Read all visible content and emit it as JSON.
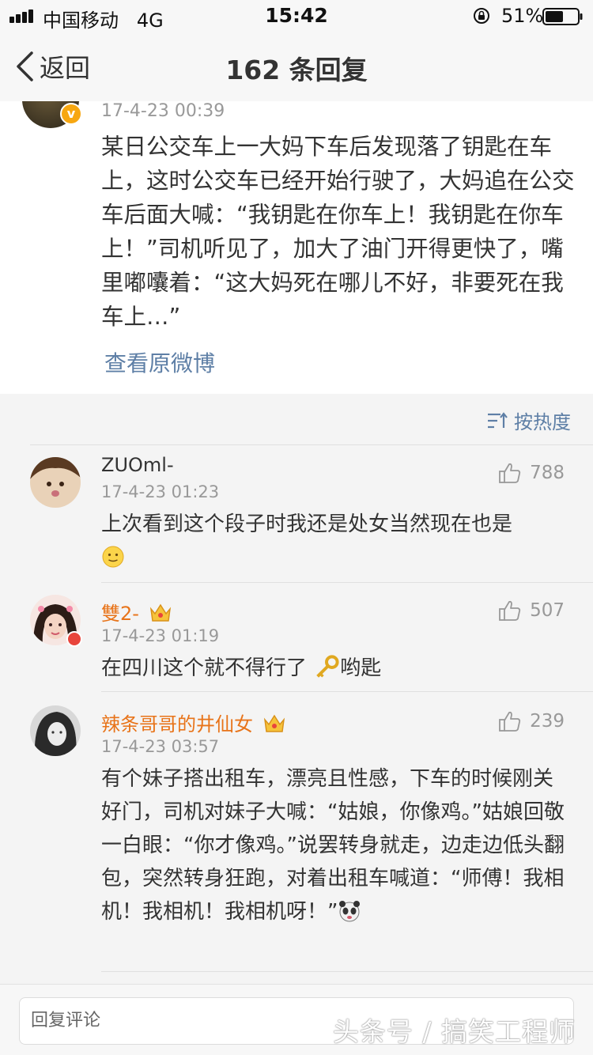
{
  "status_bar": {
    "carrier": "中国移动",
    "network": "4G",
    "time": "15:42",
    "battery": "51%"
  },
  "nav": {
    "back_label": "返回",
    "title": "162 条回复"
  },
  "post": {
    "time": "17-4-23 00:39",
    "text": "某日公交车上一大妈下车后发现落了钥匙在车上，这时公交车已经开始行驶了，大妈追在公交车后面大喊：“我钥匙在你车上！我钥匙在你车上！”司机听见了，加大了油门开得更快了，嘴里嘟囔着：“这大妈死在哪儿不好，非要死在我车上…”",
    "view_original": "查看原微博"
  },
  "sort": {
    "label": "按热度"
  },
  "comments": [
    {
      "name": "ZUOml-",
      "time": "17-4-23 01:23",
      "text": "上次看到这个段子时我还是处女当然现在也是",
      "likes": "788"
    },
    {
      "name": "雙2-",
      "time": "17-4-23 01:19",
      "text_a": "在四川这个就不得行了 ",
      "text_b": "哟匙",
      "likes": "507"
    },
    {
      "name": "辣条哥哥的井仙女",
      "time": "17-4-23 03:57",
      "text": "有个妹子搭出租车，漂亮且性感，下车的时候刚关好门，司机对妹子大喊：“姑娘，你像鸡。”姑娘回敬一白眼：“你才像鸡。”说罢转身就走，边走边低头翻包，突然转身狂跑，对着出租车喊道：“师傅！我相机！我相机！我相机呀！”",
      "likes": "239"
    }
  ],
  "reply": {
    "placeholder": "回复评论"
  },
  "watermark": "头条号 / 搞笑工程师",
  "colors": {
    "link": "#5e7fa6",
    "vip_name": "#e8741a",
    "normal_name": "#333333",
    "meta": "#999999"
  }
}
